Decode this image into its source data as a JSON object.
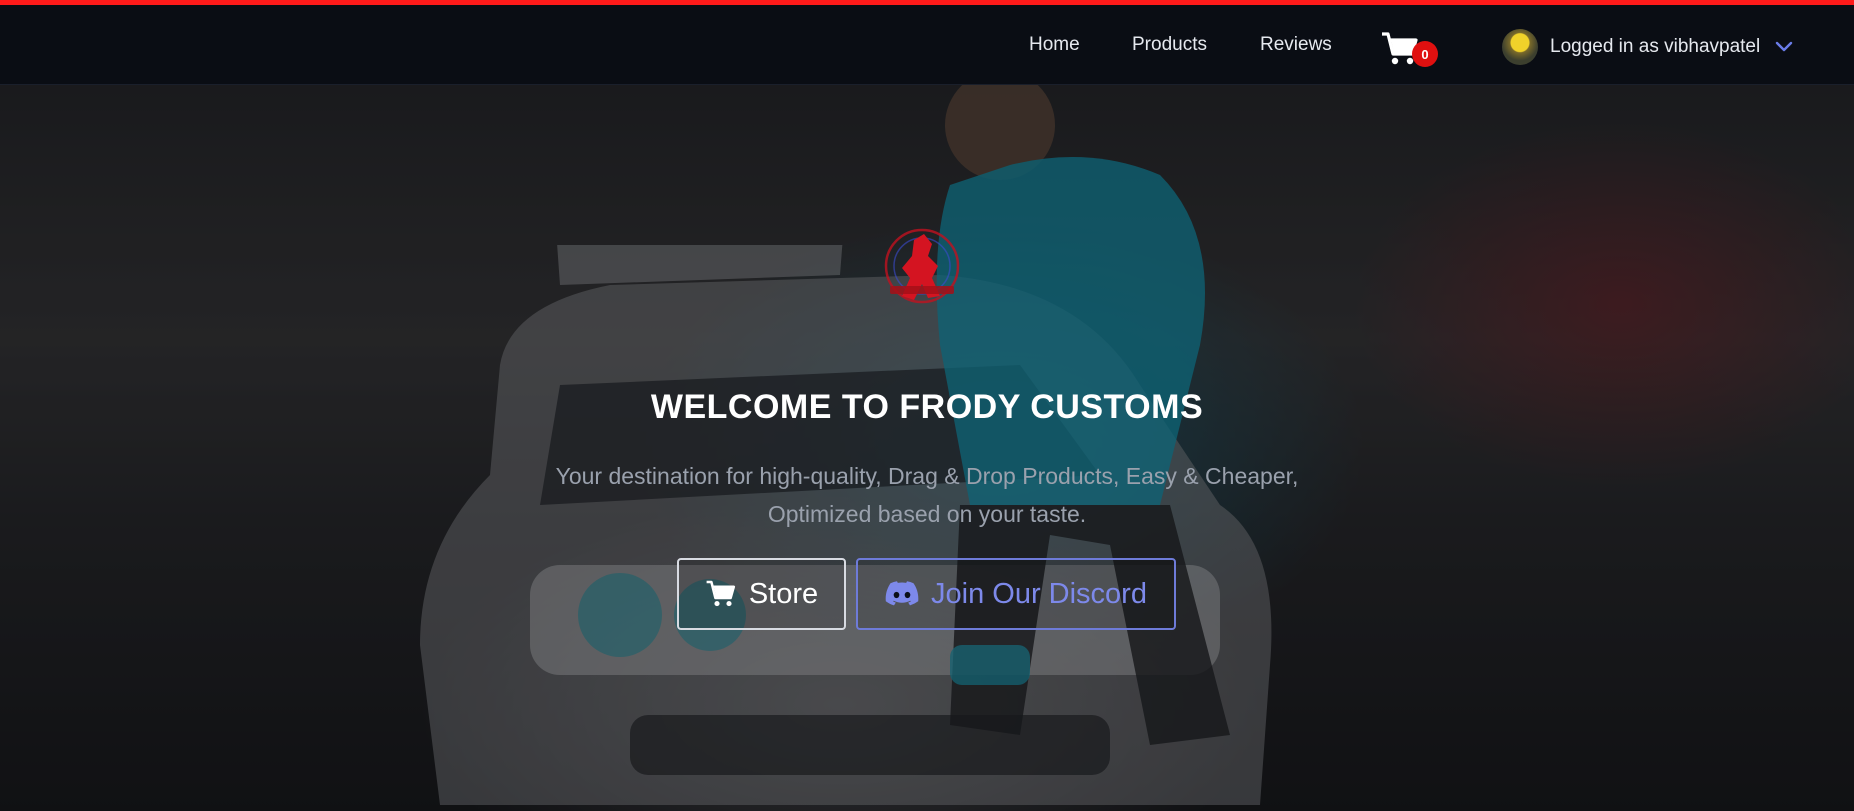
{
  "colors": {
    "accent_bar": "#ff1a1a",
    "nav_bg": "#0a0d14",
    "cart_badge": "#e01010",
    "discord": "#7d89ea"
  },
  "nav": {
    "links": [
      "Home",
      "Products",
      "Reviews"
    ],
    "cart_count": "0",
    "cart_icon": "cart-icon",
    "user_label": "Logged in as vibhavpatel",
    "caret_icon": "chevron-down-icon"
  },
  "hero": {
    "title": "WELCOME TO FRODY CUSTOMS",
    "subtitle_line1": "Your destination for high-quality, Drag & Drop Products, Easy & Cheaper,",
    "subtitle_line2": "Optimized based on your taste.",
    "store_button": "Store",
    "discord_button": "Join Our Discord",
    "store_icon": "cart-icon",
    "discord_icon": "discord-icon",
    "logo_icon": "frody-logo"
  }
}
